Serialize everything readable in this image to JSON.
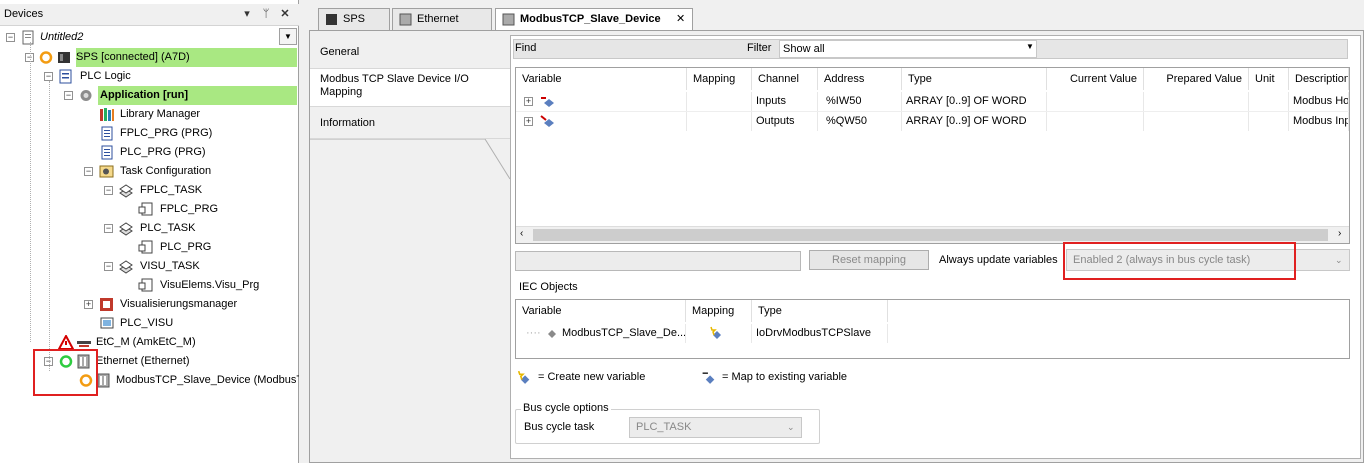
{
  "devices": {
    "title": "Devices",
    "pin_icon": "pin-icon",
    "close_icon": "close-icon",
    "tree": [
      {
        "label": "Untitled2",
        "italic": true
      },
      {
        "label": "SPS [connected] (A7D)"
      },
      {
        "label": "PLC Logic"
      },
      {
        "label": "Application [run]"
      },
      {
        "label": "Library Manager"
      },
      {
        "label": "FPLC_PRG (PRG)"
      },
      {
        "label": "PLC_PRG (PRG)"
      },
      {
        "label": "Task Configuration"
      },
      {
        "label": "FPLC_TASK"
      },
      {
        "label": "FPLC_PRG"
      },
      {
        "label": "PLC_TASK"
      },
      {
        "label": "PLC_PRG"
      },
      {
        "label": "VISU_TASK"
      },
      {
        "label": "VisuElems.Visu_Prg"
      },
      {
        "label": "Visualisierungsmanager"
      },
      {
        "label": "PLC_VISU"
      },
      {
        "label": "EtC_M (AmkEtC_M)"
      },
      {
        "label": "Ethernet (Ethernet)"
      },
      {
        "label": "ModbusTCP_Slave_Device (ModbusTC"
      }
    ]
  },
  "tabs": [
    {
      "label": "SPS"
    },
    {
      "label": "Ethernet"
    },
    {
      "label": "ModbusTCP_Slave_Device"
    }
  ],
  "side_tabs": [
    {
      "label": "General"
    },
    {
      "label": "Modbus TCP Slave Device I/O Mapping"
    },
    {
      "label": "Information"
    }
  ],
  "findbar": {
    "find": "Find",
    "filter": "Filter",
    "filter_value": "Show all"
  },
  "mapping_table": {
    "headers": [
      "Variable",
      "Mapping",
      "Channel",
      "Address",
      "Type",
      "Current Value",
      "Prepared Value",
      "Unit",
      "Description"
    ],
    "rows": [
      {
        "channel": "Inputs",
        "address": "%IW50",
        "type": "ARRAY [0..9] OF WORD",
        "description": "Modbus Holding"
      },
      {
        "channel": "Outputs",
        "address": "%QW50",
        "type": "ARRAY [0..9] OF WORD",
        "description": "Modbus Input"
      }
    ]
  },
  "reset_mapping": "Reset mapping",
  "always_update": {
    "label": "Always update variables",
    "value": "Enabled 2 (always in bus cycle task)"
  },
  "iec": {
    "title": "IEC Objects",
    "headers": [
      "Variable",
      "Mapping",
      "Type"
    ],
    "row": {
      "variable": "ModbusTCP_Slave_De...",
      "type": "IoDrvModbusTCPSlave"
    }
  },
  "legend": {
    "create": "= Create new variable",
    "map": "= Map to existing variable"
  },
  "bus_cycle": {
    "title": "Bus cycle options",
    "label": "Bus cycle task",
    "value": "PLC_TASK"
  },
  "colors": {
    "highlight_green": "#a9e882",
    "annotation_red": "#e02020"
  }
}
